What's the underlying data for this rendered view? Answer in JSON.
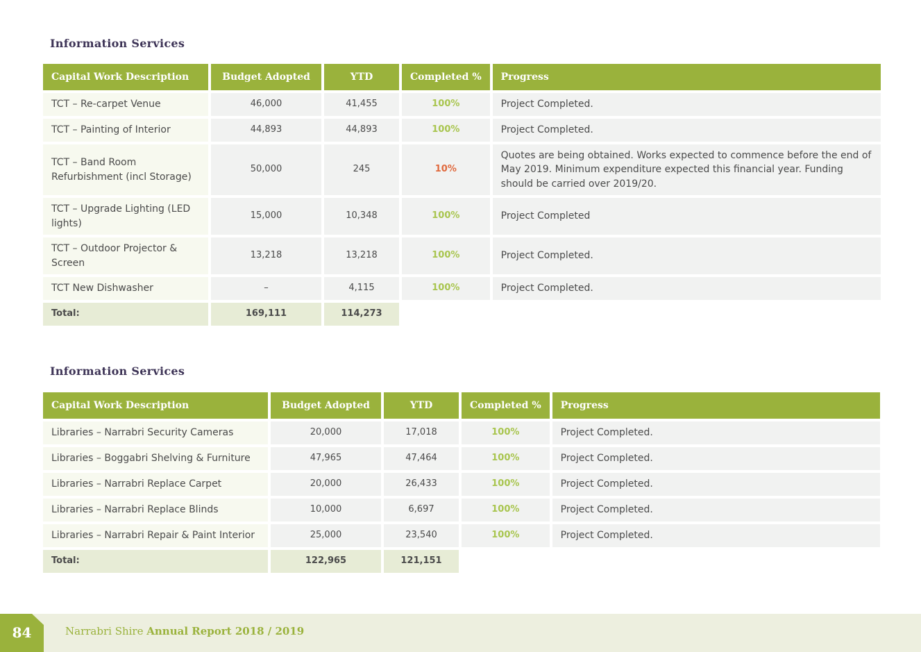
{
  "section1": {
    "title": "Information Services",
    "headers": [
      "Capital Work Description",
      "Budget Adopted",
      "YTD",
      "Completed %",
      "Progress"
    ],
    "rows": [
      {
        "description": "TCT – Re-carpet Venue",
        "budget": "46,000",
        "ytd": "41,455",
        "completed": "100%",
        "progress": "Project Completed."
      },
      {
        "description": "TCT – Painting of Interior",
        "budget": "44,893",
        "ytd": "44,893",
        "completed": "100%",
        "progress": "Project Completed."
      },
      {
        "description": "TCT – Band Room Refurbishment (incl Storage)",
        "budget": "50,000",
        "ytd": "245",
        "completed": "10%",
        "progress": "Quotes are being obtained. Works expected to commence before the end of May 2019. Minimum expenditure expected this financial year. Funding should be carried over 2019/20."
      },
      {
        "description": "TCT – Upgrade Lighting (LED lights)",
        "budget": "15,000",
        "ytd": "10,348",
        "completed": "100%",
        "progress": "Project Completed"
      },
      {
        "description": "TCT – Outdoor Projector & Screen",
        "budget": "13,218",
        "ytd": "13,218",
        "completed": "100%",
        "progress": "Project Completed."
      },
      {
        "description": "TCT New Dishwasher",
        "budget": "–",
        "ytd": "4,115",
        "completed": "100%",
        "progress": "Project Completed."
      }
    ],
    "total": {
      "label": "Total:",
      "budget": "169,111",
      "ytd": "114,273"
    }
  },
  "section2": {
    "title": "Information Services",
    "headers": [
      "Capital Work Description",
      "Budget Adopted",
      "YTD",
      "Completed %",
      "Progress"
    ],
    "rows": [
      {
        "description": "Libraries – Narrabri Security Cameras",
        "budget": "20,000",
        "ytd": "17,018",
        "completed": "100%",
        "progress": "Project Completed."
      },
      {
        "description": "Libraries – Boggabri Shelving & Furniture",
        "budget": "47,965",
        "ytd": "47,464",
        "completed": "100%",
        "progress": "Project Completed."
      },
      {
        "description": "Libraries – Narrabri Replace Carpet",
        "budget": "20,000",
        "ytd": "26,433",
        "completed": "100%",
        "progress": "Project Completed."
      },
      {
        "description": "Libraries – Narrabri Replace Blinds",
        "budget": "10,000",
        "ytd": "6,697",
        "completed": "100%",
        "progress": "Project Completed."
      },
      {
        "description": "Libraries – Narrabri Repair & Paint Interior",
        "budget": "25,000",
        "ytd": "23,540",
        "completed": "100%",
        "progress": "Project Completed."
      }
    ],
    "total": {
      "label": "Total:",
      "budget": "122,965",
      "ytd": "121,151"
    }
  },
  "footer": {
    "page_number": "84",
    "shire": "Narrabri Shire",
    "report": "Annual Report 2018 / 2019"
  },
  "colors": {
    "accent_green": "#9ab23c",
    "title_purple": "#3d3356",
    "incomplete_orange": "#e0693d",
    "complete_green": "#a8c54e"
  }
}
